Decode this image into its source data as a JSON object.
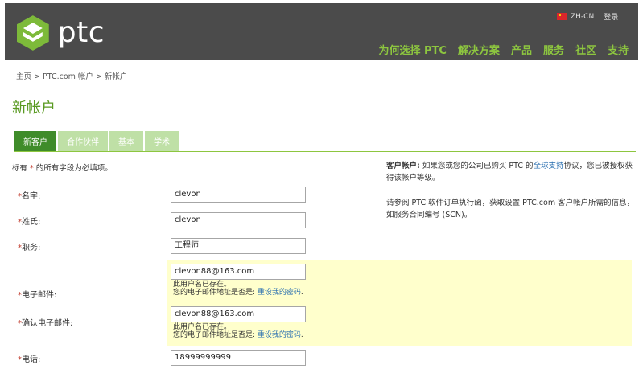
{
  "header": {
    "logo_text": "ptc",
    "lang": "ZH-CN",
    "login": "登录",
    "nav": [
      "为何选择 PTC",
      "解决方案",
      "产品",
      "服务",
      "社区",
      "支持"
    ]
  },
  "breadcrumb": "主页 > PTC.com 帐户 > 新帐户",
  "page_title": "新帐户",
  "tabs": [
    "新客户",
    "合作伙伴",
    "基本",
    "学术"
  ],
  "required_note": {
    "prefix": "标有 ",
    "star": "*",
    "suffix": " 的所有字段为必填项。"
  },
  "form": {
    "star": "*",
    "name_label": "名字:",
    "name_value": "clevon",
    "surname_label": "姓氏:",
    "surname_value": "clevon",
    "job_label": "职务:",
    "job_value": "工程师",
    "email_label": "电子邮件:",
    "email_value": "clevon88@163.com",
    "confirm_email_label": "确认电子邮件:",
    "confirm_email_value": "clevon88@163.com",
    "phone_label": "电话:",
    "phone_value": "18999999999",
    "error_line1": "此用户名已存在。",
    "error_line2_prefix": "您的电子邮件地址是否是: ",
    "error_link": "重设我的密码",
    "error_line2_suffix": "."
  },
  "side": {
    "p1_bold": "客户帐户:",
    "p1_text": " 如果您或您的公司已购买 PTC 的",
    "p1_link": "全球支持",
    "p1_tail": "协议，您已被授权获得该帐户等级。",
    "p2": "请参阅 PTC 软件订单执行函，获取设置 PTC.com 客户帐户所需的信息，如服务合同编号 (SCN)。"
  },
  "colors": {
    "header_bg": "#4b4b4b",
    "nav_green": "#8dc63f",
    "active_tab": "#3f8c2a",
    "highlight": "#ffffcc"
  }
}
